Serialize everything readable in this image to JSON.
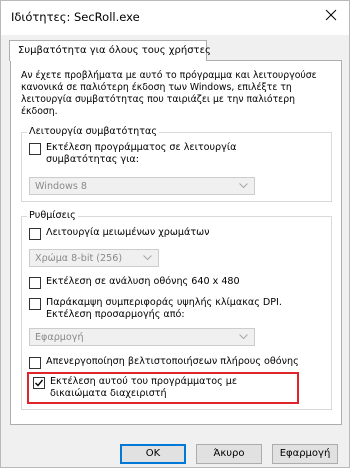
{
  "window": {
    "title": "Ιδιότητες: SecRoll.exe"
  },
  "tabs": [
    {
      "label": "Συμβατότητα για όλους τους χρήστες"
    }
  ],
  "intro_text": "Αν έχετε προβλήματα με αυτό το πρόγραμμα και λειτουργούσε κανονικά σε παλιότερη έκδοση των Windows, επιλέξτε τη λειτουργία συμβατότητας που ταιριάζει με την παλιότερη έκδοση.",
  "compat_mode": {
    "title": "Λειτουργία συμβατότητας",
    "checkbox_label": "Εκτέλεση προγράμματος σε λειτουργία συμβατότητας για:",
    "checked": false,
    "os_select": {
      "value": "Windows 8",
      "enabled": false
    }
  },
  "settings": {
    "title": "Ρυθμίσεις",
    "reduced_color": {
      "label": "Λειτουργία μειωμένων χρωμάτων",
      "checked": false
    },
    "color_select": {
      "value": "Χρώμα 8-bit (256)",
      "enabled": false
    },
    "resolution": {
      "label": "Εκτέλεση σε ανάλυση οθόνης 640 x 480",
      "checked": false
    },
    "dpi": {
      "label": "Παράκαμψη συμπεριφοράς υψηλής κλίμακας DPI. Εκτέλεση προσαρμογής από:",
      "checked": false
    },
    "scaling_select": {
      "value": "Εφαρμογή",
      "enabled": false
    },
    "fullscreen": {
      "label": "Απενεργοποίηση βελτιστοποιήσεων πλήρους οθόνης",
      "checked": false
    },
    "admin": {
      "label": "Εκτέλεση αυτού του προγράμματος με δικαιώματα διαχειριστή",
      "checked": true
    }
  },
  "buttons": {
    "ok": "OK",
    "cancel": "Άκυρο",
    "apply": "Εφαρμογή"
  },
  "colors": {
    "highlight": "#e1232a",
    "default_button_border": "#0078d7"
  },
  "icons": {
    "close": "close-icon",
    "combo_arrow": "chevron-down-icon",
    "check": "checkmark-icon"
  }
}
